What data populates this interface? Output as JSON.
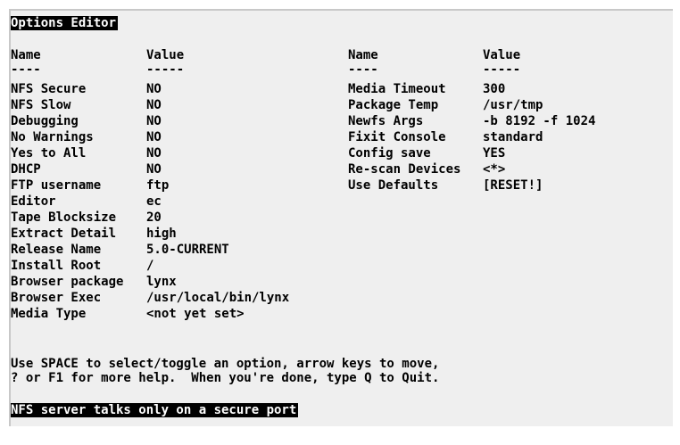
{
  "window": {
    "title": "Options Editor"
  },
  "headers": {
    "name": "Name",
    "value": "Value",
    "rule_name": "----",
    "rule_value": "-----"
  },
  "left_options": [
    {
      "name": "NFS Secure",
      "value": "NO"
    },
    {
      "name": "NFS Slow",
      "value": "NO"
    },
    {
      "name": "Debugging",
      "value": "NO"
    },
    {
      "name": "No Warnings",
      "value": "NO"
    },
    {
      "name": "Yes to All",
      "value": "NO"
    },
    {
      "name": "DHCP",
      "value": "NO"
    },
    {
      "name": "FTP username",
      "value": "ftp"
    },
    {
      "name": "Editor",
      "value": "ec"
    },
    {
      "name": "Tape Blocksize",
      "value": "20"
    },
    {
      "name": "Extract Detail",
      "value": "high"
    },
    {
      "name": "Release Name",
      "value": "5.0-CURRENT"
    },
    {
      "name": "Install Root",
      "value": "/"
    },
    {
      "name": "Browser package",
      "value": "lynx"
    },
    {
      "name": "Browser Exec",
      "value": "/usr/local/bin/lynx"
    },
    {
      "name": "Media Type",
      "value": "<not yet set>"
    }
  ],
  "right_options": [
    {
      "name": "Media Timeout",
      "value": "300"
    },
    {
      "name": "Package Temp",
      "value": "/usr/tmp"
    },
    {
      "name": "Newfs Args",
      "value": "-b 8192 -f 1024"
    },
    {
      "name": "Fixit Console",
      "value": "standard"
    },
    {
      "name": "Config save",
      "value": "YES"
    },
    {
      "name": "Re-scan Devices",
      "value": "<*>"
    },
    {
      "name": "Use Defaults",
      "value": "[RESET!]"
    }
  ],
  "help": {
    "line1": "Use SPACE to select/toggle an option, arrow keys to move,",
    "line2": "? or F1 for more help.  When you're done, type Q to Quit."
  },
  "status": {
    "text": "NFS server talks only on a secure port"
  }
}
